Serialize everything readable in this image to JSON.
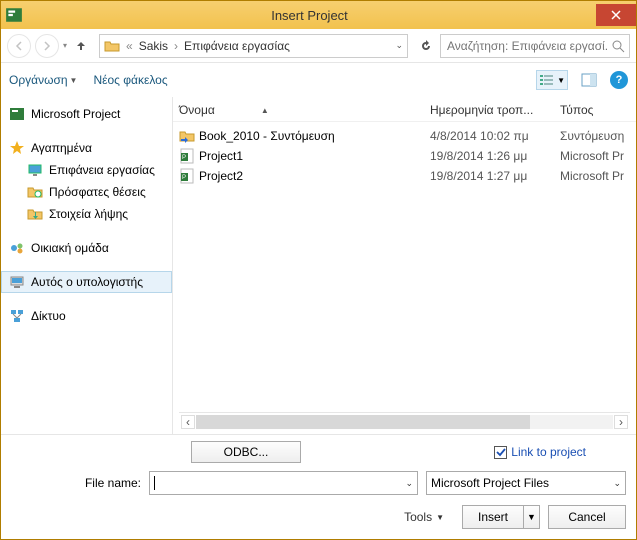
{
  "title": "Insert Project",
  "breadcrumb": {
    "sep": "«",
    "part1": "Sakis",
    "part2": "Επιφάνεια εργασίας"
  },
  "search": {
    "placeholder": "Αναζήτηση: Επιφάνεια εργασί..."
  },
  "toolbar": {
    "organize": "Οργάνωση",
    "newfolder": "Νέος φάκελος"
  },
  "sidebar": {
    "msproject": "Microsoft Project",
    "favorites": "Αγαπημένα",
    "desktop": "Επιφάνεια εργασίας",
    "recent": "Πρόσφατες θέσεις",
    "downloads": "Στοιχεία λήψης",
    "homegroup": "Οικιακή ομάδα",
    "thispc": "Αυτός ο υπολογιστής",
    "network": "Δίκτυο"
  },
  "columns": {
    "name": "Όνομα",
    "date": "Ημερομηνία τροπ...",
    "type": "Τύπος"
  },
  "files": [
    {
      "name": "Book_2010 - Συντόμευση",
      "date": "4/8/2014 10:02 πμ",
      "type": "Συντόμευση",
      "icon": "shortcut"
    },
    {
      "name": "Project1",
      "date": "19/8/2014 1:26 μμ",
      "type": "Microsoft Pr",
      "icon": "project"
    },
    {
      "name": "Project2",
      "date": "19/8/2014 1:27 μμ",
      "type": "Microsoft Pr",
      "icon": "project"
    }
  ],
  "footer": {
    "odbc": "ODBC...",
    "link_label": "Link to project",
    "filename_label": "File name:",
    "filename_value": "",
    "filter": "Microsoft Project Files",
    "tools": "Tools",
    "insert": "Insert",
    "cancel": "Cancel"
  }
}
